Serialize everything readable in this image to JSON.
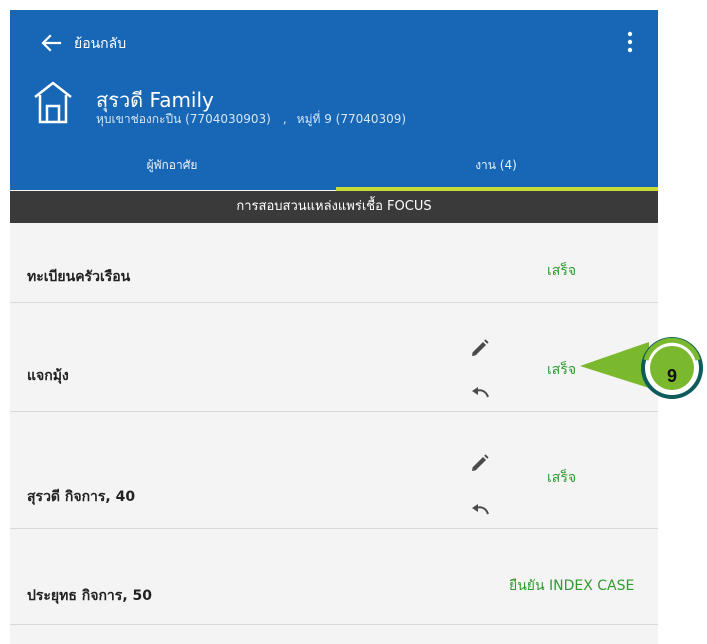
{
  "header": {
    "back_label": "ย้อนกลับ",
    "family_name": "สุรวดี Family",
    "village_code": "หุบเขาช่องกะปืน (7704030903)",
    "separator": ",",
    "moo_code": "หมู่ที่ 9 (77040309)",
    "icons": {
      "back": "arrow-left-icon",
      "menu": "more-vert-icon",
      "house": "house-icon"
    }
  },
  "tabs": [
    {
      "label": "ผู้พักอาศัย",
      "active": false
    },
    {
      "label": "งาน (4)",
      "active": true
    }
  ],
  "banner": "การสอบสวนแหล่งแพร่เชื้อ FOCUS",
  "tasks": [
    {
      "label": "ทะเบียนครัวเรือน",
      "status": "เสร็จ",
      "has_actions": false
    },
    {
      "label": "แจกมุ้ง",
      "status": "เสร็จ",
      "has_actions": true
    },
    {
      "label": "สุรวดี  กิจการ, 40",
      "status": "เสร็จ",
      "has_actions": true
    },
    {
      "label": "ประยุทธ  กิจการ, 50",
      "status": "ยืนยัน INDEX CASE",
      "has_actions": false
    }
  ],
  "callout": {
    "number": "9"
  },
  "colors": {
    "appbar": "#1767b6",
    "tab_indicator": "#c8d93a",
    "banner": "#3a3a3a",
    "status_green": "#2e9b2e",
    "callout_fill": "#7ab82e",
    "callout_ring": "#0e5b5b"
  }
}
